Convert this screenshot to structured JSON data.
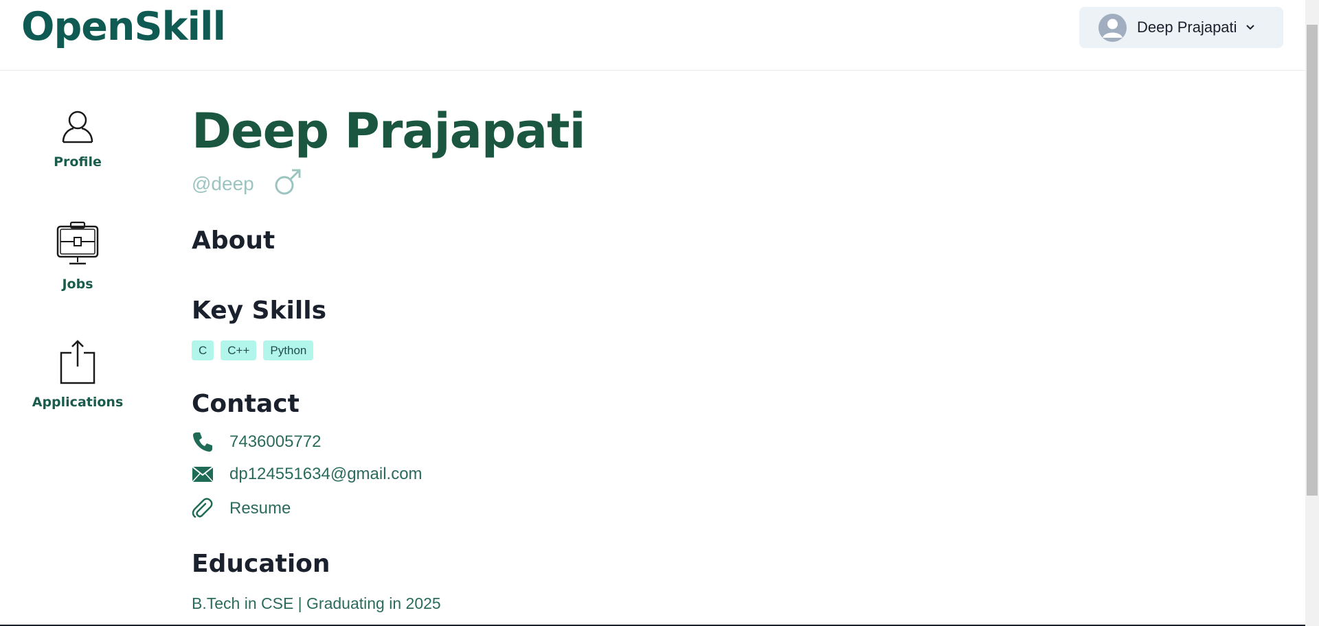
{
  "header": {
    "logo": "OpenSkill",
    "user_menu_name": "Deep Prajapati"
  },
  "sidebar": {
    "items": [
      {
        "label": "Profile",
        "icon": "user-icon"
      },
      {
        "label": "Jobs",
        "icon": "briefcase-icon"
      },
      {
        "label": "Applications",
        "icon": "upload-icon"
      }
    ]
  },
  "profile": {
    "name": "Deep Prajapati",
    "handle": "@deep",
    "gender_icon": "male-icon",
    "about_title": "About",
    "skills_title": "Key Skills",
    "skills": [
      "C",
      "C++",
      "Python"
    ],
    "contact_title": "Contact",
    "phone": "7436005772",
    "email": "dp124551634@gmail.com",
    "resume": "Resume",
    "education_title": "Education",
    "education": "B.Tech in CSE | Graduating in 2025"
  },
  "colors": {
    "brand": "#0f5a52",
    "name": "#1b5641",
    "skill_bg": "#b2f5ea"
  }
}
